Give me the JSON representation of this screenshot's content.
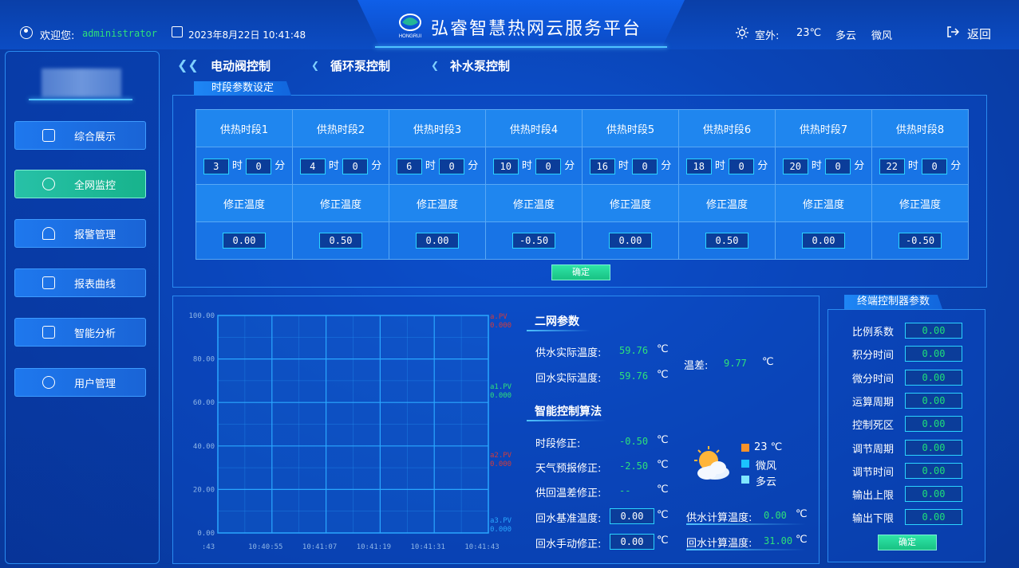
{
  "header": {
    "title": "弘睿智慧热网云服务平台",
    "welcome_label": "欢迎您:",
    "username": "administrator",
    "datetime": "2023年8月22日  10:41:48",
    "weather_label": "室外:",
    "temp": "23℃",
    "sky": "多云",
    "wind": "微风",
    "back_label": "返回",
    "logo_text": "HONGRUI"
  },
  "sidebar": {
    "items": [
      {
        "label": "综合展示",
        "icon": "monitor-play-icon"
      },
      {
        "label": "全网监控",
        "icon": "camera-icon"
      },
      {
        "label": "报警管理",
        "icon": "alarm-light-icon"
      },
      {
        "label": "报表曲线",
        "icon": "report-icon"
      },
      {
        "label": "智能分析",
        "icon": "analysis-chart-icon"
      },
      {
        "label": "用户管理",
        "icon": "user-settings-icon"
      }
    ],
    "active": "全网监控"
  },
  "tabs": [
    {
      "label": "电动阀控制"
    },
    {
      "label": "循环泵控制"
    },
    {
      "label": "补水泵控制"
    }
  ],
  "period_panel": {
    "title": "时段参数设定",
    "hour_unit": "时",
    "min_unit": "分",
    "correction_label": "修正温度",
    "confirm": "确定",
    "periods": [
      {
        "name": "供热时段1",
        "hour": "3",
        "min": "0",
        "corr": "0.00"
      },
      {
        "name": "供热时段2",
        "hour": "4",
        "min": "0",
        "corr": "0.50"
      },
      {
        "name": "供热时段3",
        "hour": "6",
        "min": "0",
        "corr": "0.00"
      },
      {
        "name": "供热时段4",
        "hour": "10",
        "min": "0",
        "corr": "-0.50"
      },
      {
        "name": "供热时段5",
        "hour": "16",
        "min": "0",
        "corr": "0.00"
      },
      {
        "name": "供热时段6",
        "hour": "18",
        "min": "0",
        "corr": "0.50"
      },
      {
        "name": "供热时段7",
        "hour": "20",
        "min": "0",
        "corr": "0.00"
      },
      {
        "name": "供热时段8",
        "hour": "22",
        "min": "0",
        "corr": "-0.50"
      }
    ]
  },
  "chart_data": {
    "type": "line",
    "yticks": [
      "100.00",
      "80.00",
      "60.00",
      "40.00",
      "20.00",
      "0.00"
    ],
    "ylim": [
      0,
      100
    ],
    "xticks": [
      ":43",
      "10:40:55",
      "10:41:07",
      "10:41:19",
      "10:41:31",
      "10:41:43"
    ],
    "grid": true,
    "series": [
      {
        "name": "a.PV",
        "value": "0.000",
        "color": "#d23b3b"
      },
      {
        "name": "a1.PV",
        "value": "0.000",
        "color": "#2ee07a"
      },
      {
        "name": "a2.PV",
        "value": "0.000",
        "color": "#d23b3b"
      },
      {
        "name": "a3.PV",
        "value": "0.000",
        "color": "#2aa7ff"
      }
    ]
  },
  "params": {
    "network_title": "二网参数",
    "supply_label": "供水实际温度:",
    "supply_value": "59.76",
    "return_label": "回水实际温度:",
    "return_value": "59.76",
    "diff_label": "温差:",
    "diff_value": "9.77",
    "unit": "℃",
    "algo_title": "智能控制算法",
    "period_corr_label": "时段修正:",
    "period_corr_value": "-0.50",
    "forecast_corr_label": "天气预报修正:",
    "forecast_corr_value": "-2.50",
    "supply_return_corr_label": "供回温差修正:",
    "supply_return_corr_value": "--",
    "return_base_label": "回水基准温度:",
    "return_base_value": "0.00",
    "return_manual_label": "回水手动修正:",
    "return_manual_value": "0.00",
    "supply_calc_label": "供水计算温度:",
    "supply_calc_value": "0.00",
    "return_calc_label": "回水计算温度:",
    "return_calc_value": "31.00",
    "weather_temp": "23  ℃",
    "weather_wind": "微风",
    "weather_sky": "多云",
    "weather_icon": "partly-cloudy-icon"
  },
  "terminal": {
    "title": "终端控制器参数",
    "confirm": "确定",
    "rows": [
      {
        "label": "比例系数",
        "value": "0.00"
      },
      {
        "label": "积分时间",
        "value": "0.00"
      },
      {
        "label": "微分时间",
        "value": "0.00"
      },
      {
        "label": "运算周期",
        "value": "0.00"
      },
      {
        "label": "控制死区",
        "value": "0.00"
      },
      {
        "label": "调节周期",
        "value": "0.00"
      },
      {
        "label": "调节时间",
        "value": "0.00"
      },
      {
        "label": "输出上限",
        "value": "0.00"
      },
      {
        "label": "输出下限",
        "value": "0.00"
      }
    ]
  },
  "colors": {
    "accent": "#2bd4ff",
    "active_nav": "#1fbf9a",
    "value_green": "#2ee07a"
  }
}
